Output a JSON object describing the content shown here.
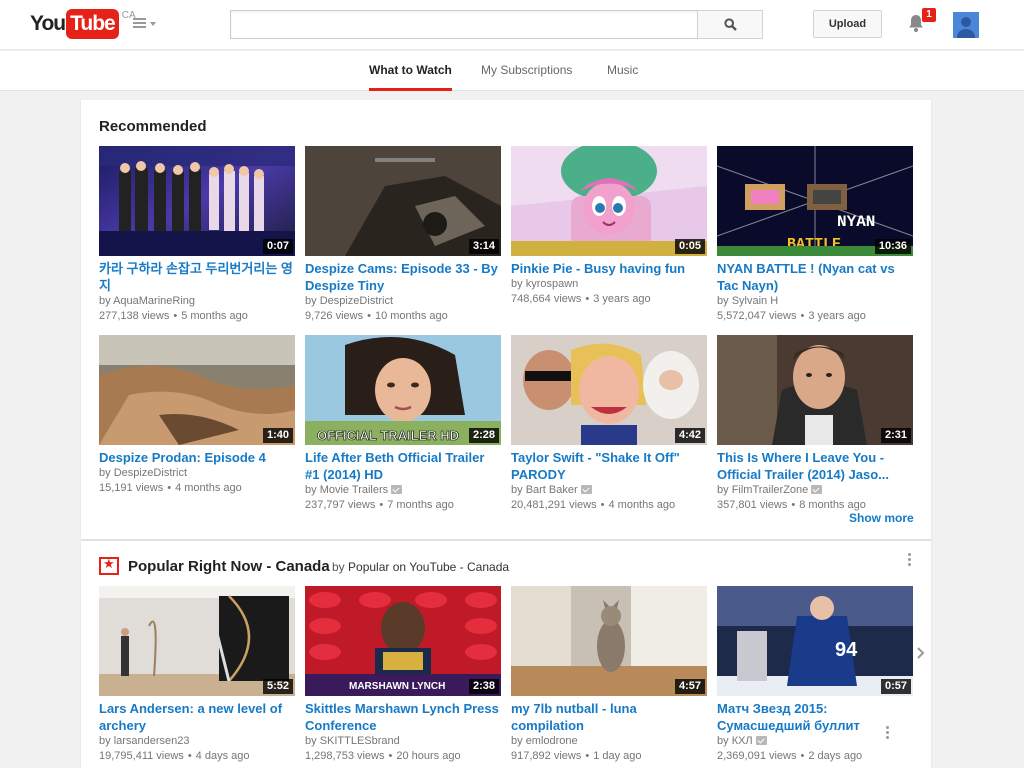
{
  "header": {
    "logo_you": "You",
    "logo_tube": "Tube",
    "region": "CA",
    "search_placeholder": "",
    "upload_label": "Upload",
    "notification_count": "1"
  },
  "tabs": [
    {
      "label": "What to Watch",
      "active": true
    },
    {
      "label": "My Subscriptions",
      "active": false
    },
    {
      "label": "Music",
      "active": false
    }
  ],
  "recommended": {
    "title": "Recommended",
    "show_more": "Show more",
    "videos": [
      {
        "title": "카라 구하라 손잡고 두리번거리는 영지",
        "channel": "AquaMarineRing",
        "views": "277,138 views",
        "age": "5 months ago",
        "duration": "0:07",
        "verified": false
      },
      {
        "title": "Despize Cams: Episode 33 - By Despize Tiny",
        "channel": "DespizeDistrict",
        "views": "9,726 views",
        "age": "10 months ago",
        "duration": "3:14",
        "verified": false
      },
      {
        "title": "Pinkie Pie - Busy having fun",
        "channel": "kyrospawn",
        "views": "748,664 views",
        "age": "3 years ago",
        "duration": "0:05",
        "verified": false
      },
      {
        "title": "NYAN BATTLE ! (Nyan cat vs Tac Nayn)",
        "channel": "Sylvain H",
        "views": "5,572,047 views",
        "age": "3 years ago",
        "duration": "10:36",
        "verified": false
      },
      {
        "title": "Despize Prodan: Episode 4",
        "channel": "DespizeDistrict",
        "views": "15,191 views",
        "age": "4 months ago",
        "duration": "1:40",
        "verified": false
      },
      {
        "title": "Life After Beth Official Trailer #1 (2014) HD",
        "channel": "Movie Trailers",
        "views": "237,797 views",
        "age": "7 months ago",
        "duration": "2:28",
        "verified": true
      },
      {
        "title": "Taylor Swift - \"Shake It Off\" PARODY",
        "channel": "Bart Baker",
        "views": "20,481,291 views",
        "age": "4 months ago",
        "duration": "4:42",
        "verified": true
      },
      {
        "title": "This Is Where I Leave You - Official Trailer (2014) Jaso...",
        "channel": "FilmTrailerZone",
        "views": "357,801 views",
        "age": "8 months ago",
        "duration": "2:31",
        "verified": true
      }
    ]
  },
  "popular": {
    "title": "Popular Right Now - Canada",
    "by_prefix": "by",
    "by_channel": "Popular on YouTube - Canada",
    "videos": [
      {
        "title": "Lars Andersen: a new level of archery",
        "channel": "larsandersen23",
        "views": "19,795,411 views",
        "age": "4 days ago",
        "duration": "5:52",
        "verified": false
      },
      {
        "title": "Skittles Marshawn Lynch Press Conference",
        "channel": "SKITTLESbrand",
        "views": "1,298,753 views",
        "age": "20 hours ago",
        "duration": "2:38",
        "verified": false
      },
      {
        "title": "my 7lb nutball - luna compilation",
        "channel": "emlodrone",
        "views": "917,892 views",
        "age": "1 day ago",
        "duration": "4:57",
        "verified": false
      },
      {
        "title": "Матч Звезд 2015: Сумасшедший буллит",
        "channel": "КХЛ",
        "views": "2,369,091 views",
        "age": "2 days ago",
        "duration": "0:57",
        "verified": true
      }
    ]
  },
  "thumb_text": {
    "trailer": "OFFICIAL TRAILER HD",
    "nyan": "NYAN",
    "battle": "BATTLE",
    "skittles_banner": "MARSHAWN LYNCH"
  },
  "colors": {
    "brand_red": "#e62117",
    "link_blue": "#167ac6",
    "meta_gray": "#767676"
  }
}
